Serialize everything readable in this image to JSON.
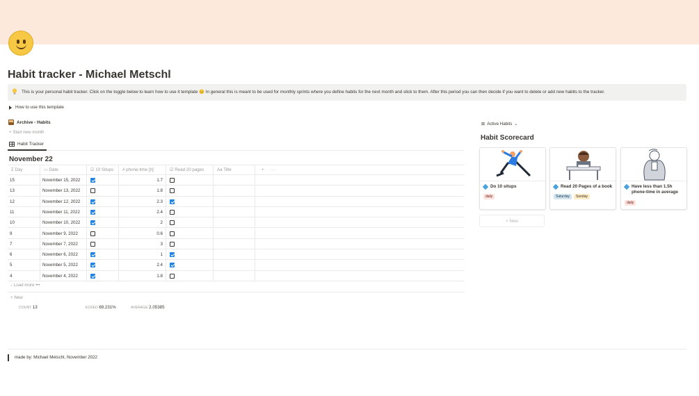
{
  "page": {
    "title": "Habit tracker - Michael Metschl",
    "icon": "smiley-face-icon",
    "cover_color": "#fde9dc"
  },
  "callout": {
    "icon": "lightbulb-icon",
    "text": "This is your personal habit tracker. Click on the toggle below to learn how to use it template 😊 In general this is meant to be used for monthly sprints where you define habits for the next month and stick to them. After this period you can then decide if you want to delete or add new habits to the tracker."
  },
  "toggle": {
    "label": "How to use this template"
  },
  "archive": {
    "label": "Archive - Habits",
    "start_new": "+ Start new month"
  },
  "table_view": {
    "tab_label": "Habit Tracker",
    "group_title": "November 22",
    "columns": {
      "day": "Day",
      "date": "Date",
      "situps": "10 Situps",
      "phone": "phone-time [h]",
      "read": "Read 20 pages",
      "title": "Title",
      "add": "+",
      "more": "···"
    },
    "rows": [
      {
        "day": "15",
        "date": "November 15, 2022",
        "situps": true,
        "phone": "1.7",
        "read": false
      },
      {
        "day": "13",
        "date": "November 13, 2022",
        "situps": false,
        "phone": "1.8",
        "read": false
      },
      {
        "day": "12",
        "date": "November 12, 2022",
        "situps": true,
        "phone": "2.3",
        "read": true
      },
      {
        "day": "11",
        "date": "November 11, 2022",
        "situps": true,
        "phone": "2.4",
        "read": false
      },
      {
        "day": "10",
        "date": "November 10, 2022",
        "situps": true,
        "phone": "2",
        "read": false
      },
      {
        "day": "9",
        "date": "November 9, 2022",
        "situps": false,
        "phone": "0.6",
        "read": false
      },
      {
        "day": "7",
        "date": "November 7, 2022",
        "situps": false,
        "phone": "3",
        "read": false
      },
      {
        "day": "6",
        "date": "November 6, 2022",
        "situps": true,
        "phone": "1",
        "read": true
      },
      {
        "day": "5",
        "date": "November 5, 2022",
        "situps": true,
        "phone": "2.4",
        "read": true
      },
      {
        "day": "4",
        "date": "November 4, 2022",
        "situps": true,
        "phone": "1.8",
        "read": false
      }
    ],
    "load_more": "↓ Load more",
    "load_more_dots": "•••",
    "new_label": "+ New",
    "calc": {
      "count_label": "COUNT",
      "count_value": "13",
      "checked_label": "ECKED",
      "checked_value": "69.231%",
      "average_label": "AVERAGE",
      "average_value": "2.05385"
    }
  },
  "gallery": {
    "view_label": "Active Habits",
    "title": "Habit Scorecard",
    "cards": [
      {
        "name": "Do 10 situps",
        "tags": [
          "daily"
        ]
      },
      {
        "name": "Read 20 Pages of a book",
        "tags": [
          "Saturday",
          "Sunday"
        ]
      },
      {
        "name": "Have less than 1.5h phone-time in average",
        "tags": [
          "daily"
        ]
      }
    ],
    "new_label": "+ New"
  },
  "footer": {
    "text": "made by: Michael Metschl, November 2022"
  },
  "colors": {
    "accent": "#2383e2",
    "diamond": "#4aa3df"
  }
}
